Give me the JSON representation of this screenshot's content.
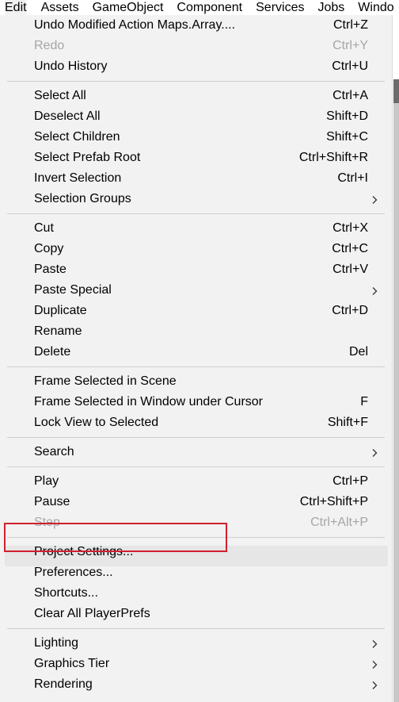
{
  "menubar": {
    "items": [
      "Edit",
      "Assets",
      "GameObject",
      "Component",
      "Services",
      "Jobs",
      "Windo"
    ]
  },
  "menu": {
    "groups": [
      [
        {
          "label": "Undo Modified Action Maps.Array....",
          "shortcut": "Ctrl+Z",
          "enabled": true
        },
        {
          "label": "Redo",
          "shortcut": "Ctrl+Y",
          "enabled": false
        },
        {
          "label": "Undo History",
          "shortcut": "Ctrl+U",
          "enabled": true
        }
      ],
      [
        {
          "label": "Select All",
          "shortcut": "Ctrl+A",
          "enabled": true
        },
        {
          "label": "Deselect All",
          "shortcut": "Shift+D",
          "enabled": true
        },
        {
          "label": "Select Children",
          "shortcut": "Shift+C",
          "enabled": true
        },
        {
          "label": "Select Prefab Root",
          "shortcut": "Ctrl+Shift+R",
          "enabled": true
        },
        {
          "label": "Invert Selection",
          "shortcut": "Ctrl+I",
          "enabled": true
        },
        {
          "label": "Selection Groups",
          "submenu": true,
          "enabled": true
        }
      ],
      [
        {
          "label": "Cut",
          "shortcut": "Ctrl+X",
          "enabled": true
        },
        {
          "label": "Copy",
          "shortcut": "Ctrl+C",
          "enabled": true
        },
        {
          "label": "Paste",
          "shortcut": "Ctrl+V",
          "enabled": true
        },
        {
          "label": "Paste Special",
          "submenu": true,
          "enabled": true
        },
        {
          "label": "Duplicate",
          "shortcut": "Ctrl+D",
          "enabled": true
        },
        {
          "label": "Rename",
          "enabled": true
        },
        {
          "label": "Delete",
          "shortcut": "Del",
          "enabled": true
        }
      ],
      [
        {
          "label": "Frame Selected in Scene",
          "enabled": true
        },
        {
          "label": "Frame Selected in Window under Cursor",
          "shortcut": "F",
          "enabled": true
        },
        {
          "label": "Lock View to Selected",
          "shortcut": "Shift+F",
          "enabled": true
        }
      ],
      [
        {
          "label": "Search",
          "submenu": true,
          "enabled": true
        }
      ],
      [
        {
          "label": "Play",
          "shortcut": "Ctrl+P",
          "enabled": true
        },
        {
          "label": "Pause",
          "shortcut": "Ctrl+Shift+P",
          "enabled": true
        },
        {
          "label": "Step",
          "shortcut": "Ctrl+Alt+P",
          "enabled": false
        }
      ],
      [
        {
          "label": "Project Settings...",
          "enabled": true,
          "highlighted": true
        },
        {
          "label": "Preferences...",
          "enabled": true
        },
        {
          "label": "Shortcuts...",
          "enabled": true
        },
        {
          "label": "Clear All PlayerPrefs",
          "enabled": true
        }
      ],
      [
        {
          "label": "Lighting",
          "submenu": true,
          "enabled": true
        },
        {
          "label": "Graphics Tier",
          "submenu": true,
          "enabled": true
        },
        {
          "label": "Rendering",
          "submenu": true,
          "enabled": true
        }
      ]
    ]
  },
  "colors": {
    "menu_bg": "#f2f2f2",
    "disabled_text": "#a6a6a6",
    "highlight_border": "#d0202e",
    "separator": "#cfcfcf"
  },
  "icons": {
    "submenu": "chevron-right-icon"
  }
}
